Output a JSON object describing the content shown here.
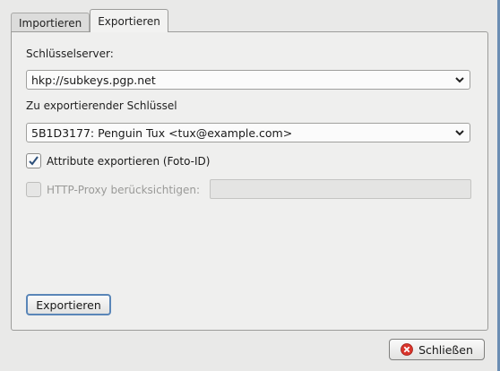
{
  "tabs": [
    {
      "label": "Importieren"
    },
    {
      "label": "Exportieren"
    }
  ],
  "keyserver": {
    "label": "Schlüsselserver:",
    "value": "hkp://subkeys.pgp.net"
  },
  "key": {
    "label": "Zu exportierender Schlüssel",
    "value": "5B1D3177: Penguin Tux <tux@example.com>"
  },
  "attributes": {
    "label": "Attribute exportieren (Foto-ID)",
    "checked": true
  },
  "proxy": {
    "label": "HTTP-Proxy berücksichtigen:",
    "checked": false,
    "value": ""
  },
  "export_button": {
    "label": "Exportieren"
  },
  "close_button": {
    "label": "Schließen",
    "icon": "close-icon"
  },
  "colors": {
    "close_icon": "#d9342b",
    "focus": "#5a86b8"
  }
}
